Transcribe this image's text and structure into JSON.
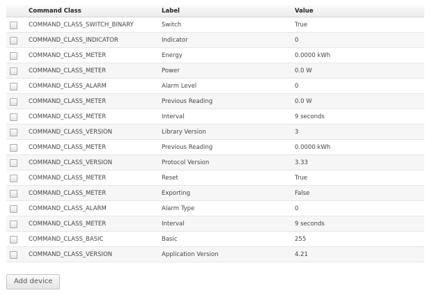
{
  "table": {
    "headers": {
      "command_class": "Command Class",
      "label": "Label",
      "value": "Value"
    },
    "rows": [
      {
        "command_class": "COMMAND_CLASS_SWITCH_BINARY",
        "label": "Switch",
        "value": "True"
      },
      {
        "command_class": "COMMAND_CLASS_INDICATOR",
        "label": "Indicator",
        "value": "0"
      },
      {
        "command_class": "COMMAND_CLASS_METER",
        "label": "Energy",
        "value": "0.0000 kWh"
      },
      {
        "command_class": "COMMAND_CLASS_METER",
        "label": "Power",
        "value": "0.0 W"
      },
      {
        "command_class": "COMMAND_CLASS_ALARM",
        "label": "Alarm Level",
        "value": "0"
      },
      {
        "command_class": "COMMAND_CLASS_METER",
        "label": "Previous Reading",
        "value": "0.0 W"
      },
      {
        "command_class": "COMMAND_CLASS_METER",
        "label": "Interval",
        "value": "9 seconds"
      },
      {
        "command_class": "COMMAND_CLASS_VERSION",
        "label": "Library Version",
        "value": "3"
      },
      {
        "command_class": "COMMAND_CLASS_METER",
        "label": "Previous Reading",
        "value": "0.0000 kWh"
      },
      {
        "command_class": "COMMAND_CLASS_VERSION",
        "label": "Protocol Version",
        "value": "3.33"
      },
      {
        "command_class": "COMMAND_CLASS_METER",
        "label": "Reset",
        "value": "True"
      },
      {
        "command_class": "COMMAND_CLASS_METER",
        "label": "Exporting",
        "value": "False"
      },
      {
        "command_class": "COMMAND_CLASS_ALARM",
        "label": "Alarm Type",
        "value": "0"
      },
      {
        "command_class": "COMMAND_CLASS_METER",
        "label": "Interval",
        "value": "9 seconds"
      },
      {
        "command_class": "COMMAND_CLASS_BASIC",
        "label": "Basic",
        "value": "255"
      },
      {
        "command_class": "COMMAND_CLASS_VERSION",
        "label": "Application Version",
        "value": "4.21"
      }
    ]
  },
  "actions": {
    "add_device_label": "Add device"
  }
}
